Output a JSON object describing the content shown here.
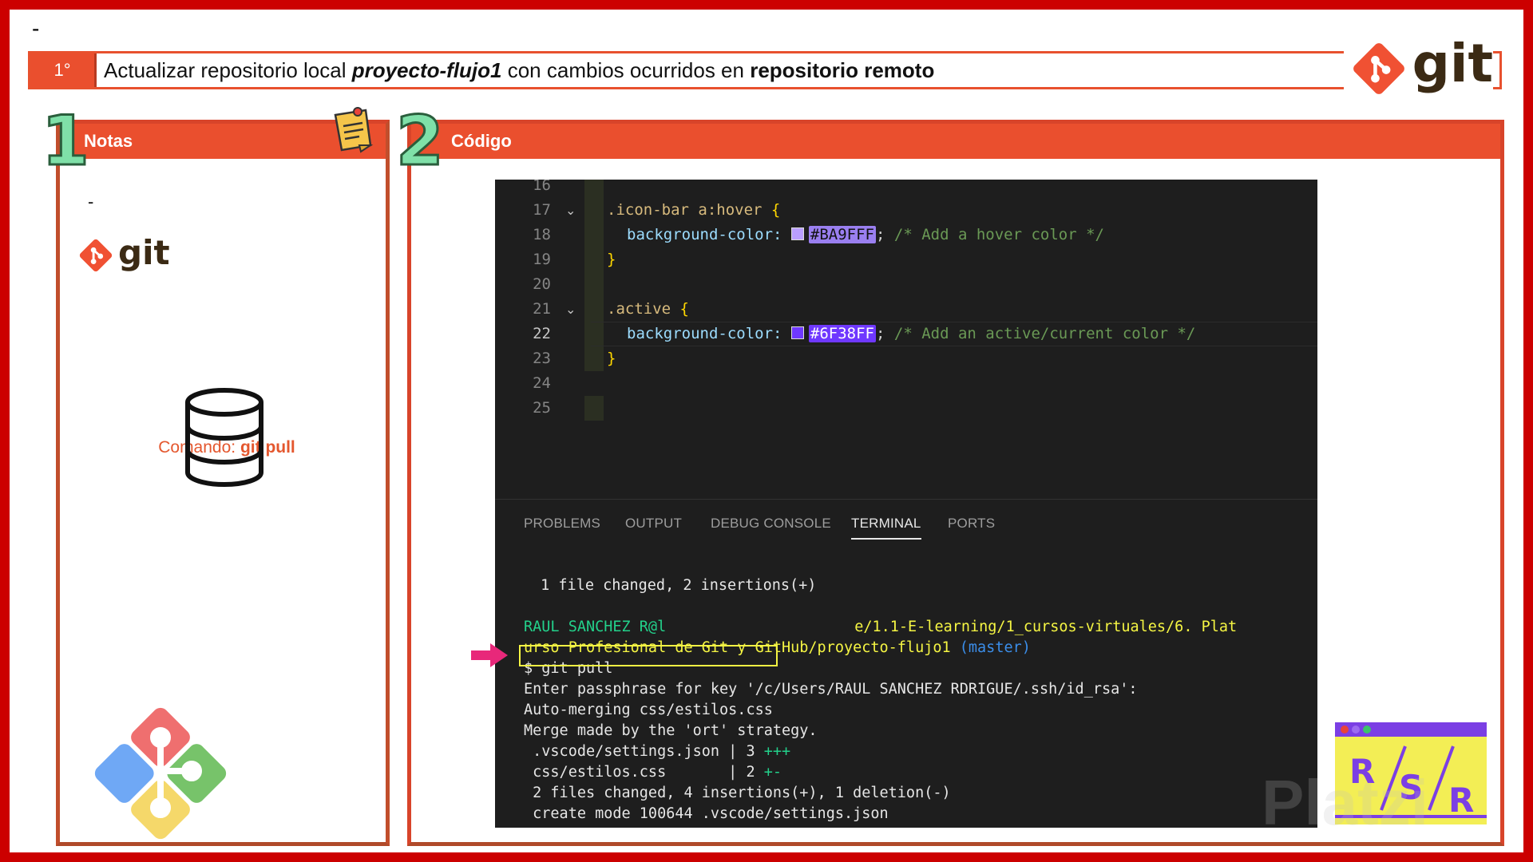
{
  "top_dash": "-",
  "header": {
    "step": "1°",
    "title_part1": "Actualizar repositorio local ",
    "title_repo": "proyecto-flujo1",
    "title_part2": " con cambios ocurridos en ",
    "title_bold": "repositorio remoto",
    "logo_text": "git"
  },
  "notes_panel": {
    "number": "1",
    "title": "Notas",
    "dash": "-",
    "logo_text": "git",
    "command_label": "Comando: ",
    "command": "git pull"
  },
  "code_panel": {
    "number": "2",
    "title": "Código"
  },
  "editor": {
    "lines": [
      {
        "n": "16"
      },
      {
        "n": "17",
        "selector": ".icon-bar a:hover ",
        "brace": "{"
      },
      {
        "n": "18",
        "prop": "background-color: ",
        "color": "#BA9FFF",
        "tail": ";",
        "comment": " /* Add a hover color */"
      },
      {
        "n": "19",
        "brace": "}"
      },
      {
        "n": "20"
      },
      {
        "n": "21",
        "selector": ".active ",
        "brace": "{"
      },
      {
        "n": "22",
        "prop": "background-color: ",
        "color": "#6F38FF",
        "tail": ";",
        "comment": " /* Add an active/current color */"
      },
      {
        "n": "23",
        "brace": "}"
      },
      {
        "n": "24"
      },
      {
        "n": "25"
      }
    ],
    "swatch_colors": [
      "#BA9FFF",
      "#6F38FF"
    ]
  },
  "panel_tabs": [
    "PROBLEMS",
    "OUTPUT",
    "DEBUG CONSOLE",
    "TERMINAL",
    "PORTS"
  ],
  "active_tab": "TERMINAL",
  "terminal": {
    "summary": " 1 file changed, 2 insertions(+)",
    "prompt_user": "RAUL SANCHEZ R@l",
    "prompt_path_right": "e/1.1-E-learning/1_cursos-virtuales/6. Plat",
    "prompt_path_line2": "urso Profesional de Git y GitHub/proyecto-flujo1",
    "branch": " (master)",
    "command": "$ git pull",
    "out1": "Enter passphrase for key '/c/Users/RAUL SANCHEZ RDRIGUE/.ssh/id_rsa':",
    "out2": "Auto-merging css/estilos.css",
    "out3": "Merge made by the 'ort' strategy.",
    "file1": " .vscode/settings.json | 3 ",
    "file1_plus": "+++",
    "file2": " css/estilos.css       | 2 ",
    "file2_diff": "+-",
    "out4": " 2 files changed, 4 insertions(+), 1 deletion(-)",
    "out5": " create mode 100644 .vscode/settings.json"
  },
  "badge": {
    "r1": "R",
    "s": "S",
    "r2": "R"
  },
  "watermark": "Platzi"
}
